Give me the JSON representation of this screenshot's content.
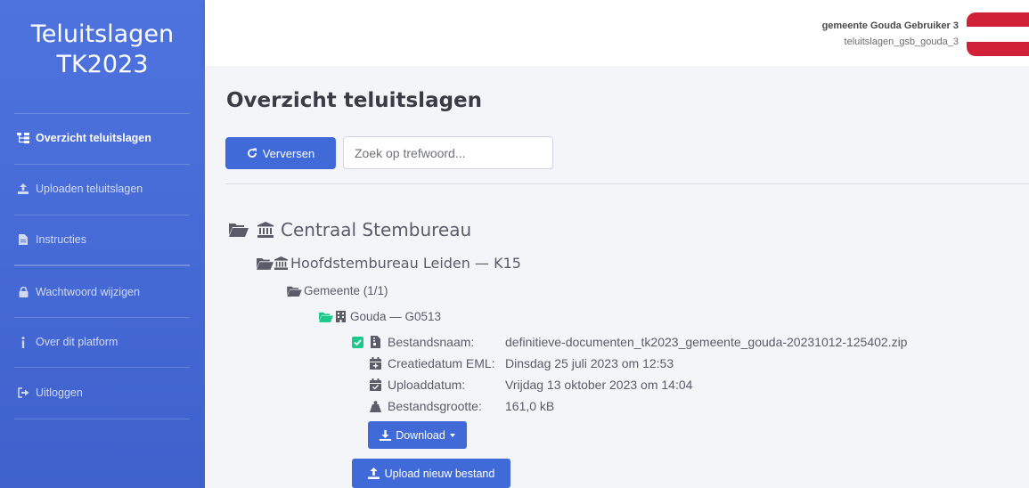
{
  "brand": {
    "line1": "Teluitslagen",
    "line2": "TK2023"
  },
  "sidebar": {
    "items": [
      {
        "label": "Overzicht teluitslagen",
        "icon": "sitemap-icon",
        "active": true
      },
      {
        "label": "Uploaden teluitslagen",
        "icon": "upload-icon",
        "active": false
      },
      {
        "label": "Instructies",
        "icon": "file-icon",
        "active": false
      },
      {
        "label": "Wachtwoord wijzigen",
        "icon": "lock-icon",
        "active": false
      },
      {
        "label": "Over dit platform",
        "icon": "info-icon",
        "active": false
      },
      {
        "label": "Uitloggen",
        "icon": "sign-out-icon",
        "active": false
      }
    ]
  },
  "header": {
    "user_name": "gemeente Gouda Gebruiker 3",
    "user_login": "teluitslagen_gsb_gouda_3",
    "flag_colors": [
      "#d02138",
      "#ffffff",
      "#d02138"
    ]
  },
  "main": {
    "title": "Overzicht teluitslagen",
    "refresh_label": "Verversen",
    "search_placeholder": "Zoek op trefwoord...",
    "search_value": ""
  },
  "tree": {
    "central": "Centraal Stembureau",
    "hsb": "Hoofdstembureau Leiden — K15",
    "gemeente": "Gemeente (1/1)",
    "gouda": "Gouda — G0513",
    "file": {
      "name_label": "Bestandsnaam:",
      "name_value": "definitieve-documenten_tk2023_gemeente_gouda-20231012-125402.zip",
      "created_label": "Creatiedatum EML:",
      "created_value": "Dinsdag 25 juli 2023 om 12:53",
      "upload_label": "Uploaddatum:",
      "upload_value": "Vrijdag 13 oktober 2023 om 14:04",
      "size_label": "Bestandsgrootte:",
      "size_value": "161,0 kB"
    },
    "download_label": "Download",
    "upload_label": "Upload nieuw bestand"
  },
  "colors": {
    "sidebar": "#4e73df",
    "primary_button": "#3f6ad8",
    "folder_green": "#1cc88a"
  }
}
